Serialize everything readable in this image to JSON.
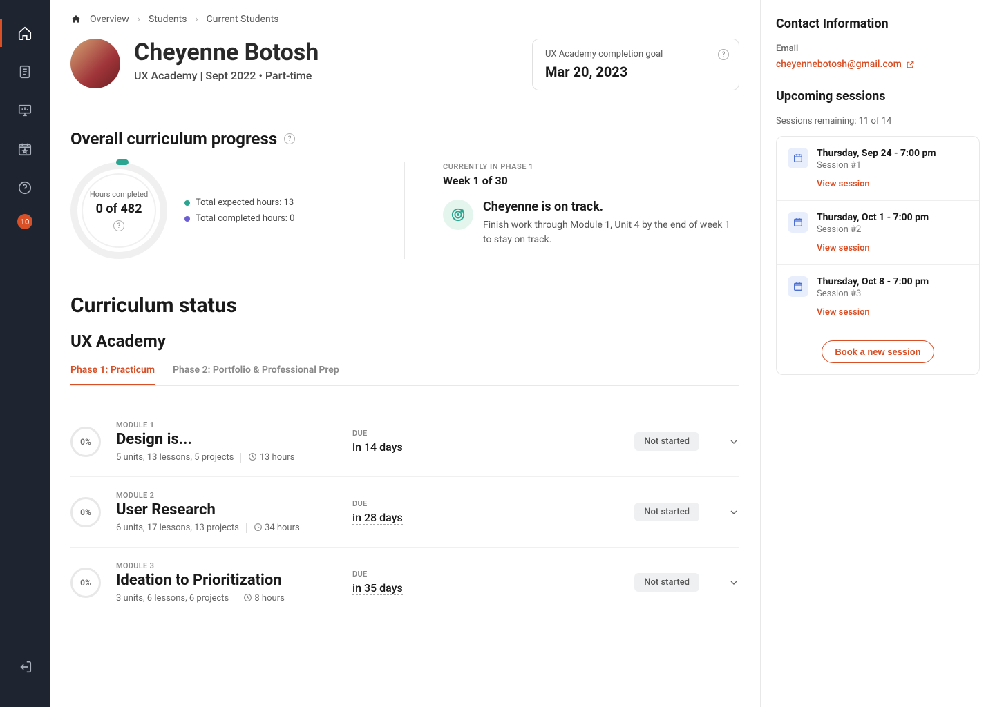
{
  "nav": {
    "badge": "10"
  },
  "breadcrumb": {
    "root": "Overview",
    "l1": "Students",
    "l2": "Current Students"
  },
  "student": {
    "name": "Cheyenne Botosh",
    "subtitle": "UX Academy | Sept 2022 • Part-time"
  },
  "goal": {
    "label": "UX Academy completion goal",
    "date": "Mar 20, 2023"
  },
  "progress": {
    "title": "Overall curriculum progress",
    "ring_label": "Hours completed",
    "ring_value": "0 of 482",
    "legend_expected": "Total expected hours: 13",
    "legend_completed": "Total completed hours: 0",
    "phase": "CURRENTLY IN PHASE 1",
    "week": "Week 1 of 30",
    "track_title": "Cheyenne is on track.",
    "track_desc_pre": "Finish work through Module 1, Unit 4 by the ",
    "track_desc_uline": "end of week 1",
    "track_desc_post": " to stay on track."
  },
  "curriculum": {
    "big": "Curriculum status",
    "sub": "UX Academy",
    "tab1": "Phase 1: Practicum",
    "tab2": "Phase 2: Portfolio & Professional Prep"
  },
  "modules": [
    {
      "pct": "0%",
      "label": "MODULE 1",
      "title": "Design is...",
      "meta": "5 units, 13 lessons, 5 projects",
      "hours": "13 hours",
      "due_label": "DUE",
      "due": "in 14 days",
      "status": "Not started"
    },
    {
      "pct": "0%",
      "label": "MODULE 2",
      "title": "User Research",
      "meta": "6 units, 17 lessons, 13 projects",
      "hours": "34 hours",
      "due_label": "DUE",
      "due": "in 28 days",
      "status": "Not started"
    },
    {
      "pct": "0%",
      "label": "MODULE 3",
      "title": "Ideation to Prioritization",
      "meta": "3 units, 6 lessons, 6 projects",
      "hours": "8 hours",
      "due_label": "DUE",
      "due": "in 35 days",
      "status": "Not started"
    }
  ],
  "contact": {
    "heading": "Contact Information",
    "email_label": "Email",
    "email": "cheyennebotosh@gmail.com"
  },
  "sessions": {
    "heading": "Upcoming sessions",
    "remaining": "Sessions remaining: 11 of 14",
    "items": [
      {
        "time": "Thursday, Sep 24 - 7:00 pm",
        "num": "Session #1",
        "link": "View session"
      },
      {
        "time": "Thursday, Oct 1 - 7:00 pm",
        "num": "Session #2",
        "link": "View session"
      },
      {
        "time": "Thursday, Oct 8 - 7:00 pm",
        "num": "Session #3",
        "link": "View session"
      }
    ],
    "book": "Book a new session"
  }
}
